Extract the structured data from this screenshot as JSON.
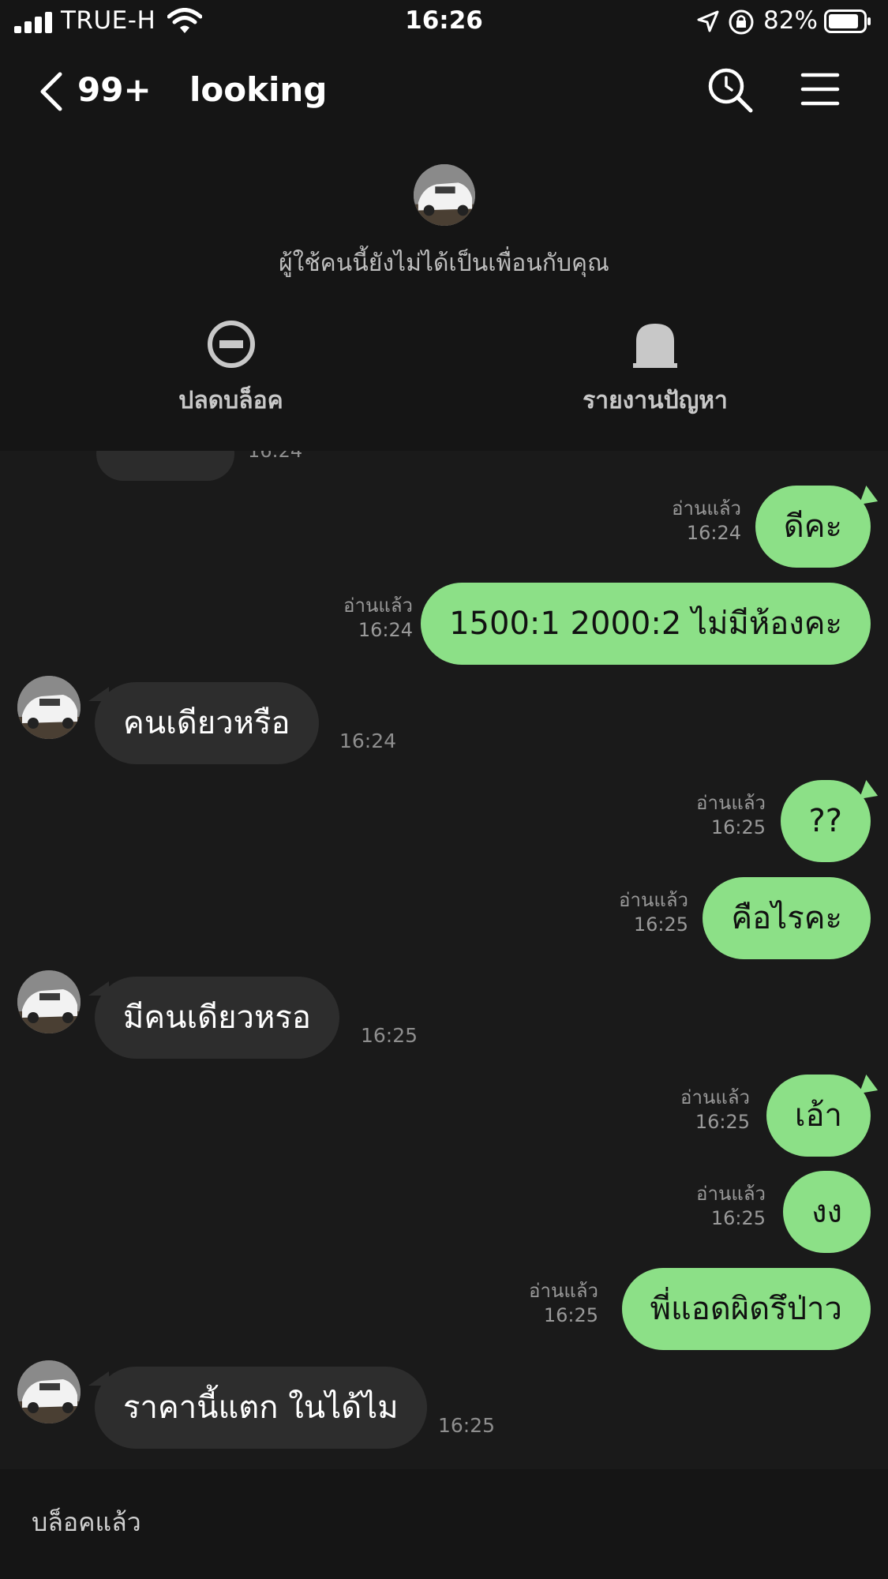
{
  "status_bar": {
    "carrier": "TRUE-H",
    "time": "16:26",
    "battery_percent": "82%",
    "icons": [
      "signal-icon",
      "wifi-icon",
      "location-icon",
      "lock-rotation-icon",
      "battery-icon"
    ]
  },
  "header": {
    "unread_count": "99+",
    "title": "looking",
    "icons": [
      "back-icon",
      "search-icon",
      "menu-icon"
    ]
  },
  "notice": {
    "text": "ผู้ใช้คนนี้ยังไม่ได้เป็นเพื่อนกับคุณ",
    "unblock_label": "ปลดบล็อค",
    "report_label": "รายงานปัญหา"
  },
  "chat": {
    "partial_time": "16:24",
    "messages": [
      {
        "direction": "out",
        "text": "ดีคะ",
        "read": "อ่านแล้ว",
        "time": "16:24"
      },
      {
        "direction": "out",
        "text": "1500:1 2000:2 ไม่มีห้องคะ",
        "read": "อ่านแล้ว",
        "time": "16:24"
      },
      {
        "direction": "in",
        "text": "คนเดียวหรือ",
        "time": "16:24"
      },
      {
        "direction": "out",
        "text": "??",
        "read": "อ่านแล้ว",
        "time": "16:25"
      },
      {
        "direction": "out",
        "text": "คือไรคะ",
        "read": "อ่านแล้ว",
        "time": "16:25"
      },
      {
        "direction": "in",
        "text": "มีคนเดียวหรอ",
        "time": "16:25"
      },
      {
        "direction": "out",
        "text": "เอ้า",
        "read": "อ่านแล้ว",
        "time": "16:25"
      },
      {
        "direction": "out",
        "text": "งง",
        "read": "อ่านแล้ว",
        "time": "16:25"
      },
      {
        "direction": "out",
        "text": "พี่แอดผิดรึป่าว",
        "read": "อ่านแล้ว",
        "time": "16:25"
      },
      {
        "direction": "in",
        "text": "ราคานี้แตก ในได้ไม",
        "time": "16:25"
      }
    ]
  },
  "footer": {
    "blocked_label": "บล็อคแล้ว"
  },
  "colors": {
    "background": "#1a1a1a",
    "outgoing_bubble": "#8ce087",
    "incoming_bubble": "#2d2d2d"
  }
}
